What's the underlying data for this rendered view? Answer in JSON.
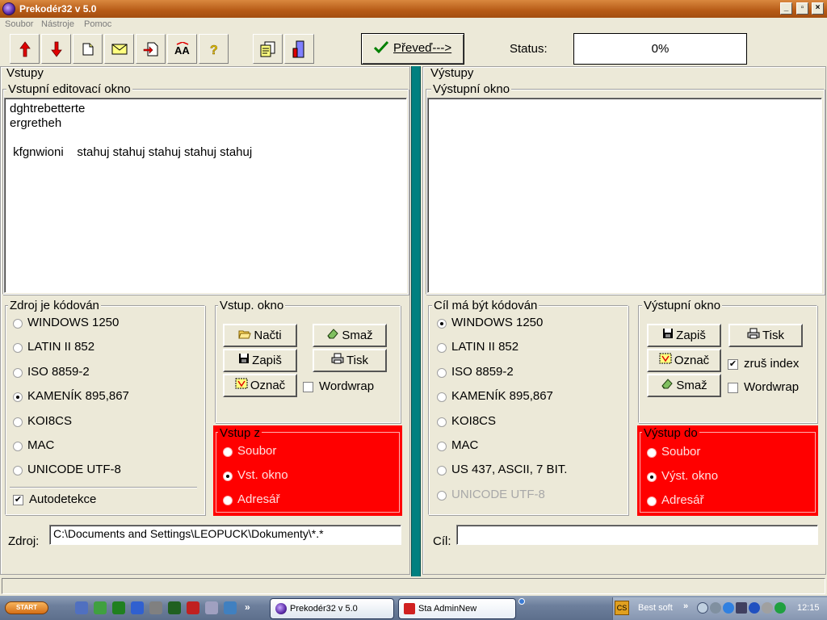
{
  "window": {
    "title": "Prekodér32 v 5.0",
    "minimize_glyph": "_",
    "restore_glyph": "▫",
    "close_glyph": "×"
  },
  "menu": {
    "items": [
      "Soubor",
      "Nástroje",
      "Pomoc"
    ]
  },
  "toolbar": {
    "icons": [
      "arrow-up-icon",
      "arrow-down-icon",
      "new-document-icon",
      "envelope-icon",
      "import-file-icon",
      "font-size-icon",
      "help-icon",
      "copy-document-icon",
      "exit-icon"
    ],
    "convert_label": "Převeď--->",
    "status_label": "Status:",
    "status_value": "0%"
  },
  "input": {
    "section_label": "Vstupy",
    "editor_label": "Vstupní editovací okno",
    "editor_text": "dghtrebetterte\nergretheh\n\n kfgnwioni    stahuj stahuj stahuj stahuj stahuj",
    "encoding_group_label": "Zdroj je kódován",
    "encodings": [
      {
        "label": "WINDOWS 1250",
        "selected": false
      },
      {
        "label": "LATIN II 852",
        "selected": false
      },
      {
        "label": "ISO 8859-2",
        "selected": false
      },
      {
        "label": "KAMENÍK 895,867",
        "selected": true
      },
      {
        "label": "KOI8CS",
        "selected": false
      },
      {
        "label": "MAC",
        "selected": false
      },
      {
        "label": "UNICODE UTF-8",
        "selected": false
      }
    ],
    "autodetect_label": "Autodetekce",
    "autodetect_checked": true,
    "window_group_label": "Vstup. okno",
    "buttons": {
      "load": "Načti",
      "clear": "Smaž",
      "save": "Zapiš",
      "print": "Tisk",
      "select": "Označ"
    },
    "wordwrap_label": "Wordwrap",
    "wordwrap_checked": false,
    "from_group_label": "Vstup z",
    "from_options": [
      {
        "label": "Soubor",
        "selected": false
      },
      {
        "label": "Vst. okno",
        "selected": true
      },
      {
        "label": "Adresář",
        "selected": false
      }
    ],
    "source_label": "Zdroj:",
    "source_value": "C:\\Documents and Settings\\LEOPUCK\\Dokumenty\\*.*"
  },
  "output": {
    "section_label": "Výstupy",
    "editor_label": "Výstupní okno",
    "editor_text": "",
    "encoding_group_label": "Cíl má být kódován",
    "encodings": [
      {
        "label": "WINDOWS 1250",
        "selected": true,
        "disabled": false
      },
      {
        "label": "LATIN II 852",
        "selected": false,
        "disabled": false
      },
      {
        "label": "ISO 8859-2",
        "selected": false,
        "disabled": false
      },
      {
        "label": "KAMENÍK 895,867",
        "selected": false,
        "disabled": false
      },
      {
        "label": "KOI8CS",
        "selected": false,
        "disabled": false
      },
      {
        "label": "MAC",
        "selected": false,
        "disabled": false
      },
      {
        "label": "US 437, ASCII, 7 BIT.",
        "selected": false,
        "disabled": false
      },
      {
        "label": "UNICODE UTF-8",
        "selected": false,
        "disabled": true
      }
    ],
    "window_group_label": "Výstupní okno",
    "buttons": {
      "save": "Zapiš",
      "print": "Tisk",
      "select": "Označ",
      "clear": "Smaž"
    },
    "remove_index_label": "zruš index",
    "remove_index_checked": true,
    "wordwrap_label": "Wordwrap",
    "wordwrap_checked": false,
    "to_group_label": "Výstup do",
    "to_options": [
      {
        "label": "Soubor",
        "selected": false
      },
      {
        "label": "Výst. okno",
        "selected": true
      },
      {
        "label": "Adresář",
        "selected": false
      }
    ],
    "target_label": "Cíl:",
    "target_value": ""
  },
  "taskbar": {
    "start_label": "START",
    "quick_launch_icons": [
      "media-player-icon",
      "refresh-icon",
      "network-icon",
      "firefox-icon",
      "tools-icon",
      "counter-icon",
      "opera-icon",
      "settings-icon",
      "screenshot-icon"
    ],
    "overflow_glyph": "»",
    "tasks": [
      {
        "label": "Prekodér32 v 5.0",
        "active": true
      },
      {
        "label": "Sta AdminNew",
        "active": false
      }
    ],
    "tray_text": "Best soft",
    "clock": "12:15"
  },
  "colors": {
    "titlebar": "#b65a16",
    "red_panel": "#ff0000",
    "divider": "#008080",
    "taskbar": "#6d7f9c"
  }
}
